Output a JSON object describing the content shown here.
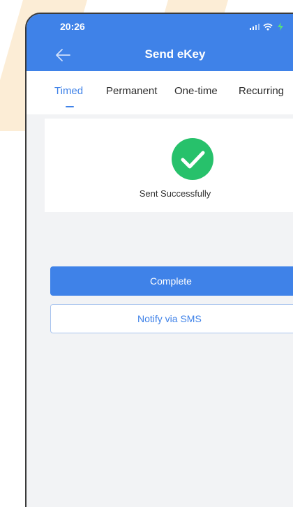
{
  "status_bar": {
    "time": "20:26",
    "icons": [
      "signal-icon",
      "wifi-icon",
      "battery-charging-icon"
    ]
  },
  "header": {
    "title": "Send eKey",
    "back_icon": "arrow-left-icon"
  },
  "tabs": [
    {
      "label": "Timed",
      "active": true
    },
    {
      "label": "Permanent",
      "active": false
    },
    {
      "label": "One-time",
      "active": false
    },
    {
      "label": "Recurring",
      "active": false
    }
  ],
  "result": {
    "icon": "check-circle-icon",
    "message": "Sent Successfully"
  },
  "actions": {
    "complete_label": "Complete",
    "sms_label": "Notify via SMS"
  },
  "colors": {
    "primary": "#3f82e8",
    "success": "#27c16b",
    "background": "#f2f3f5",
    "watermark": "#fbe7c8"
  }
}
